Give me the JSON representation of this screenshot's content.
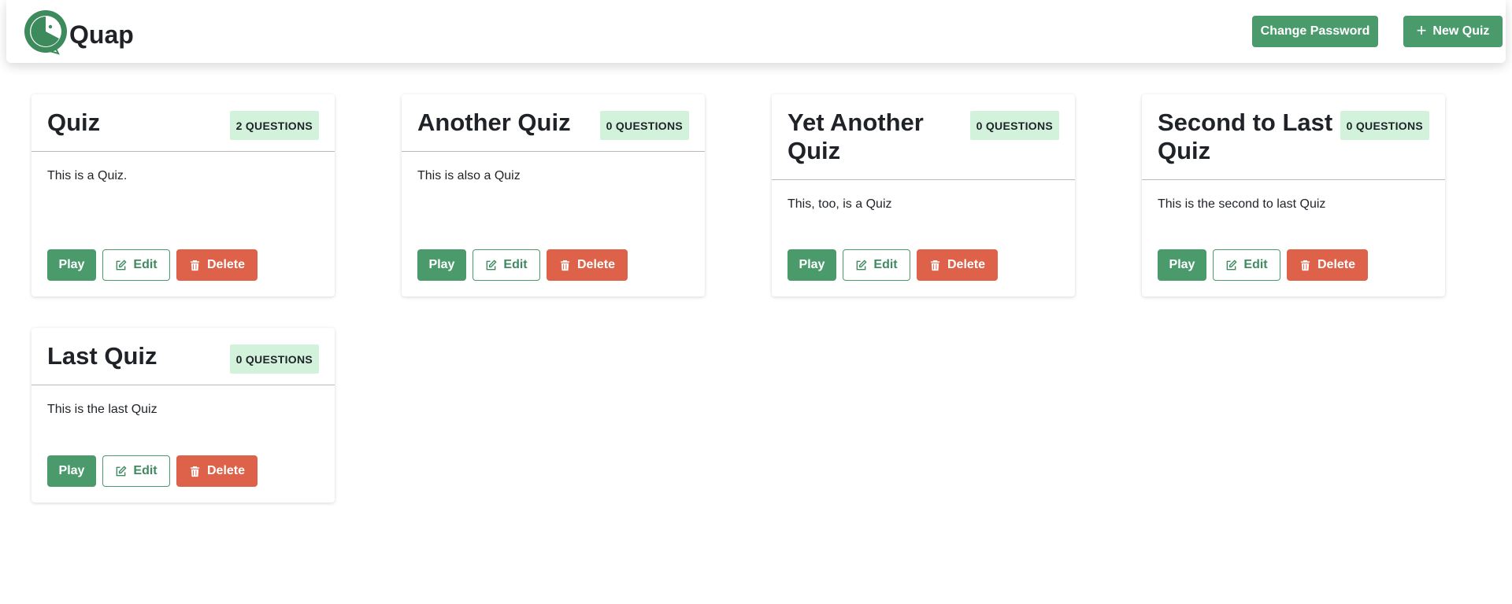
{
  "app": {
    "name": "Quap"
  },
  "nav": {
    "change_password": "Change Password",
    "new_quiz": "New Quiz",
    "new_quiz_icon": "plus-icon"
  },
  "card_buttons": {
    "play": "Play",
    "edit": "Edit",
    "delete": "Delete",
    "edit_icon": "edit-icon",
    "delete_icon": "trash-icon"
  },
  "quizzes": [
    {
      "title": "Quiz",
      "badge": "2 QUESTIONS",
      "description": "This is a Quiz."
    },
    {
      "title": "Another Quiz",
      "badge": "0 QUESTIONS",
      "description": "This is also a Quiz"
    },
    {
      "title": "Yet Another Quiz",
      "badge": "0 QUESTIONS",
      "description": "This, too, is a Quiz"
    },
    {
      "title": "Second to Last Quiz",
      "badge": "0 QUESTIONS",
      "description": "This is the second to last Quiz"
    },
    {
      "title": "Last Quiz",
      "badge": "0 QUESTIONS",
      "description": "This is the last Quiz"
    }
  ],
  "colors": {
    "primary": "#4a9a6c",
    "danger": "#dd6249",
    "badge_bg": "#d2f2dc"
  }
}
